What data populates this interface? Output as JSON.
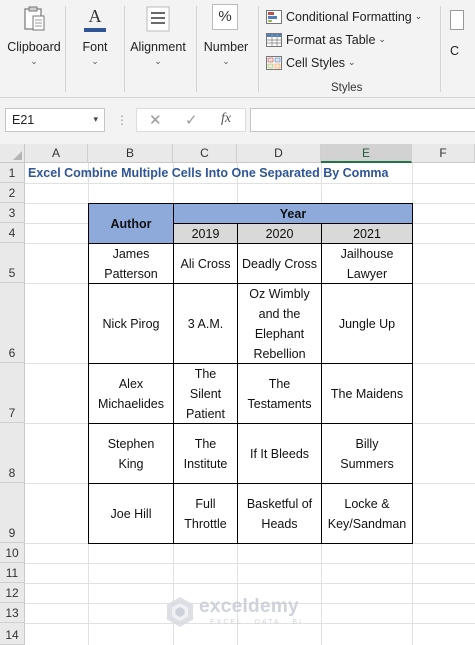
{
  "ribbon": {
    "clipboard": "Clipboard",
    "font": "Font",
    "alignment": "Alignment",
    "number": "Number",
    "number_icon": "%",
    "font_icon": "A",
    "conditional_formatting": "Conditional Formatting",
    "format_as_table": "Format as Table",
    "cell_styles": "Cell Styles",
    "styles_group": "Styles",
    "cut_off_group": "C"
  },
  "formula_bar": {
    "name_box": "E21",
    "cancel_icon": "✕",
    "enter_icon": "✓",
    "fx_label": "fx",
    "formula": ""
  },
  "grid": {
    "columns": [
      "A",
      "B",
      "C",
      "D",
      "E",
      "F"
    ],
    "selected_column": "E",
    "rows": [
      "1",
      "2",
      "3",
      "4",
      "5",
      "6",
      "7",
      "8",
      "9",
      "10",
      "11",
      "12",
      "13",
      "14"
    ]
  },
  "sheet": {
    "title": "Excel Combine Multiple Cells Into One Separated By Comma",
    "title_color": "#2f5597",
    "header_color": "#8eaadb",
    "year_row_color": "#d9d9d9",
    "table": {
      "author_header": "Author",
      "year_header": "Year",
      "years": [
        "2019",
        "2020",
        "2021"
      ],
      "rows": [
        {
          "author": "James Patterson",
          "y2019": "Ali Cross",
          "y2020": "Deadly Cross",
          "y2021": "Jailhouse Lawyer"
        },
        {
          "author": "Nick Pirog",
          "y2019": "3 A.M.",
          "y2020": "Oz Wimbly and the Elephant Rebellion",
          "y2021": "Jungle Up"
        },
        {
          "author": "Alex Michaelides",
          "y2019": "The Silent Patient",
          "y2020": "The Testaments",
          "y2021": "The Maidens"
        },
        {
          "author": "Stephen King",
          "y2019": "The Institute",
          "y2020": "If It Bleeds",
          "y2021": "Billy Summers"
        },
        {
          "author": "Joe Hill",
          "y2019": "Full Throttle",
          "y2020": "Basketful of Heads",
          "y2021": "Locke & Key/Sandman"
        }
      ]
    }
  },
  "watermark": {
    "name": "exceldemy",
    "tagline": "EXCEL · DATA · BI"
  }
}
